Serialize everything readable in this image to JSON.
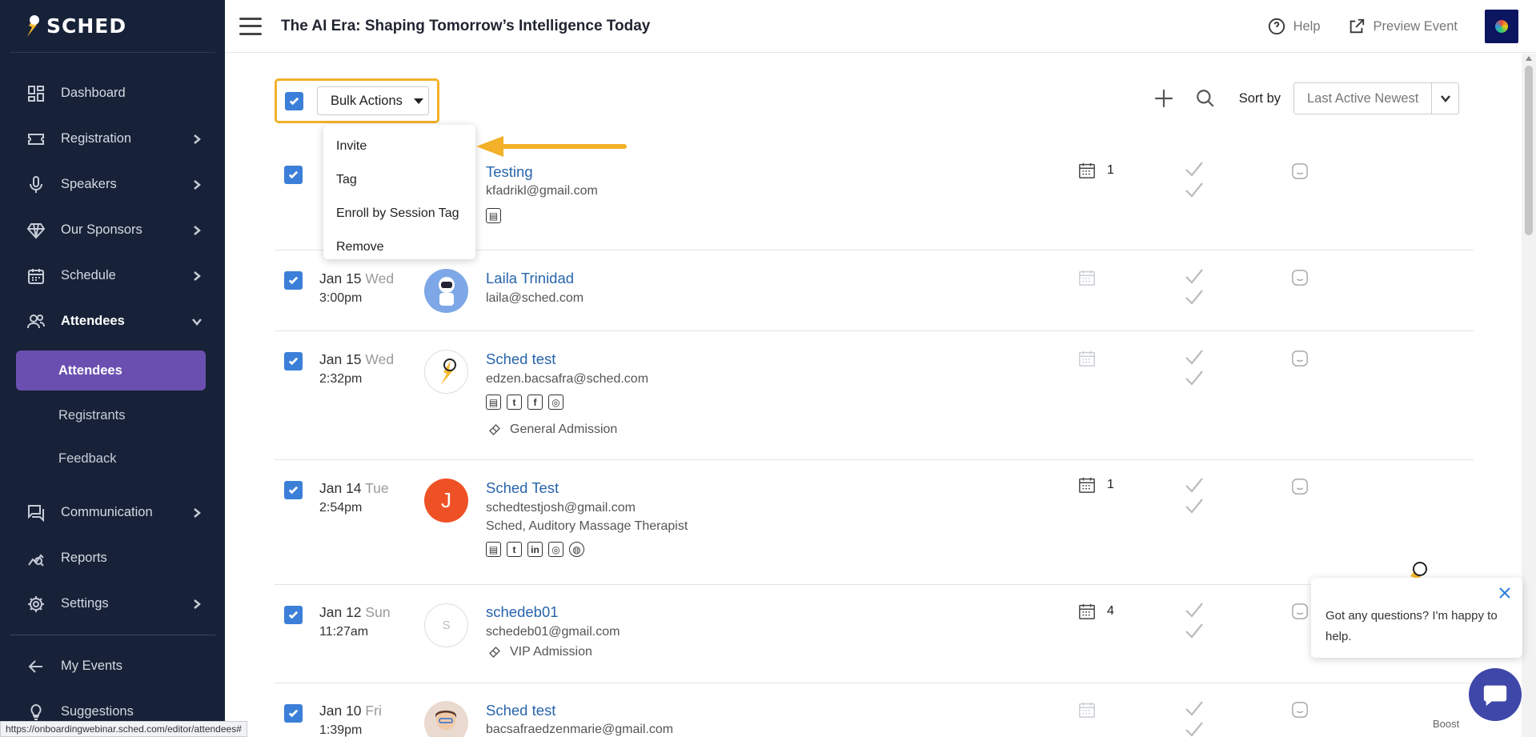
{
  "app": {
    "logo_text": "SCHED"
  },
  "header": {
    "event_title": "The AI Era: Shaping Tomorrow’s Intelligence Today",
    "help_label": "Help",
    "preview_label": "Preview Event"
  },
  "sidebar": {
    "items": [
      {
        "label": "Dashboard",
        "icon": "dashboard-icon"
      },
      {
        "label": "Registration",
        "icon": "ticket-icon"
      },
      {
        "label": "Speakers",
        "icon": "microphone-icon"
      },
      {
        "label": "Our Sponsors",
        "icon": "diamond-icon"
      },
      {
        "label": "Schedule",
        "icon": "calendar-icon"
      },
      {
        "label": "Attendees",
        "icon": "users-icon"
      }
    ],
    "attendees_sub": {
      "active": "Attendees",
      "registrants": "Registrants",
      "feedback": "Feedback"
    },
    "lower_items": [
      {
        "label": "Communication",
        "icon": "chat-icon"
      },
      {
        "label": "Reports",
        "icon": "reports-icon"
      },
      {
        "label": "Settings",
        "icon": "gear-icon"
      }
    ],
    "footer_items": [
      {
        "label": "My Events",
        "icon": "arrow-left-icon"
      },
      {
        "label": "Suggestions",
        "icon": "lightbulb-icon"
      }
    ]
  },
  "toolbar": {
    "bulk_actions_label": "Bulk Actions",
    "sort_by_label": "Sort by",
    "sort_value": "Last Active Newest"
  },
  "bulk_menu": {
    "items": [
      "Invite",
      "Tag",
      "Enroll by Session Tag",
      "Remove"
    ]
  },
  "attendees": [
    {
      "name": "Testing",
      "email": "kfadrikl@gmail.com",
      "cal_count": "1"
    },
    {
      "date": "Jan 15",
      "dow": "Wed",
      "time": "3:00pm",
      "name": "Laila Trinidad",
      "email": "laila@sched.com"
    },
    {
      "date": "Jan 15",
      "dow": "Wed",
      "time": "2:32pm",
      "name": "Sched test",
      "email": "edzen.bacsafra@sched.com",
      "ticket": "General Admission"
    },
    {
      "date": "Jan 14",
      "dow": "Tue",
      "time": "2:54pm",
      "name": "Sched Test",
      "email": "schedtestjosh@gmail.com",
      "company": "Sched, Auditory Massage Therapist",
      "avatar_letter": "J",
      "cal_count": "1"
    },
    {
      "date": "Jan 12",
      "dow": "Sun",
      "time": "11:27am",
      "name": "schedeb01",
      "email": "schedeb01@gmail.com",
      "ticket": "VIP Admission",
      "avatar_letter": "S",
      "cal_count": "4"
    },
    {
      "date": "Jan 10",
      "dow": "Fri",
      "time": "1:39pm",
      "name": "Sched test",
      "email": "bacsafraedzenmarie@gmail.com"
    }
  ],
  "chat": {
    "message": "Got any questions? I'm happy to help.",
    "boost_label": "Boost"
  },
  "status_url": "https://onboardingwebinar.sched.com/editor/attendees#",
  "colors": {
    "sidebar_bg": "#172238",
    "active_purple": "#6b4fb0",
    "highlight_yellow": "#f2b129",
    "link_blue": "#2764ab",
    "checkbox_blue": "#3b7fd8"
  }
}
